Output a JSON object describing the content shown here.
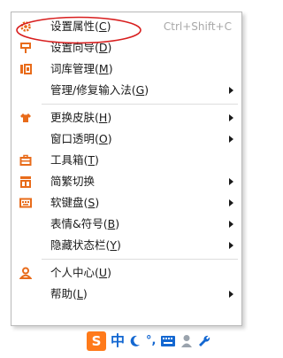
{
  "menu": {
    "items": [
      {
        "label": "设置属性",
        "mnemonic": "C",
        "shortcut": "Ctrl+Shift+C",
        "icon": "gear-icon",
        "submenu": false
      },
      {
        "label": "设置向导",
        "mnemonic": "D",
        "icon": "wizard-icon",
        "submenu": false
      },
      {
        "label": "词库管理",
        "mnemonic": "M",
        "icon": "dictionary-icon",
        "submenu": false
      },
      {
        "label": "管理/修复输入法",
        "mnemonic": "G",
        "icon": "",
        "submenu": true
      },
      {
        "label": "更换皮肤",
        "mnemonic": "H",
        "icon": "shirt-icon",
        "submenu": true
      },
      {
        "label": "窗口透明",
        "mnemonic": "O",
        "icon": "",
        "submenu": true
      },
      {
        "label": "工具箱",
        "mnemonic": "T",
        "icon": "toolbox-icon",
        "submenu": false
      },
      {
        "label": "简繁切换",
        "mnemonic": "",
        "icon": "simplified-traditional-icon",
        "submenu": true
      },
      {
        "label": "软键盘",
        "mnemonic": "S",
        "icon": "keyboard-icon",
        "submenu": true
      },
      {
        "label": "表情&符号",
        "mnemonic": "B",
        "icon": "",
        "submenu": true
      },
      {
        "label": "隐藏状态栏",
        "mnemonic": "Y",
        "icon": "",
        "submenu": true
      },
      {
        "label": "个人中心",
        "mnemonic": "U",
        "icon": "user-icon",
        "submenu": false
      },
      {
        "label": "帮助",
        "mnemonic": "L",
        "icon": "",
        "submenu": true
      }
    ]
  },
  "taskbar": {
    "logo": "S",
    "mode": "中",
    "width_icon": "moon-icon",
    "punct": "°,",
    "keyboard_icon": "keyboard-icon",
    "user_icon": "user-icon",
    "tool_icon": "wrench-icon"
  },
  "colors": {
    "accent_orange": "#ff7a1a",
    "accent_blue": "#1367d1",
    "highlight_red": "#d81e1e"
  }
}
